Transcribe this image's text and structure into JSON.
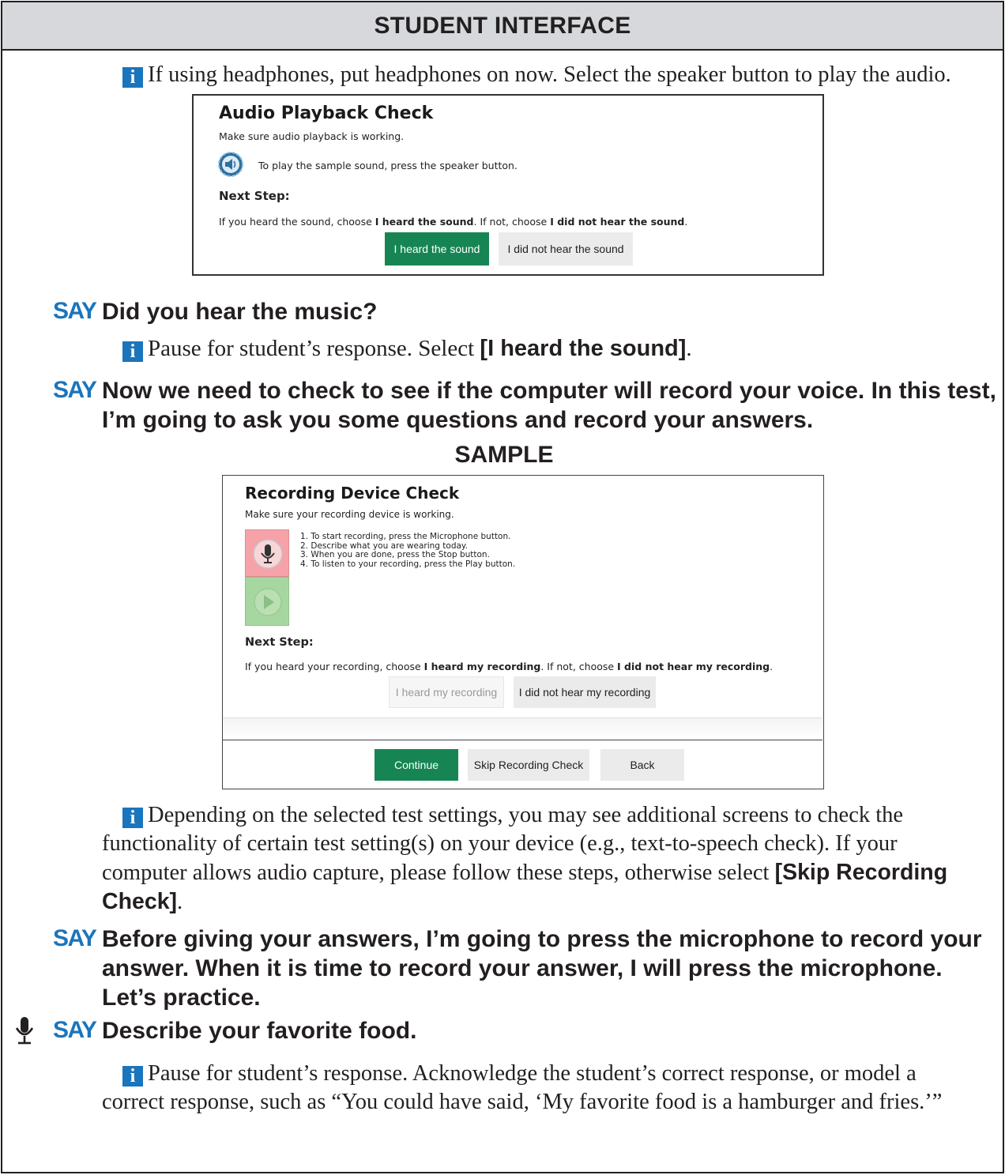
{
  "header": {
    "title": "STUDENT INTERFACE"
  },
  "info1": "If using headphones, put headphones on now. Select the speaker button to play the audio.",
  "audio_check": {
    "title": "Audio Playback Check",
    "subtitle": "Make sure audio playback is working.",
    "speaker_text": "To play the sample sound, press the speaker button.",
    "next_step": "Next Step:",
    "instr_pre": "If you heard the sound, choose ",
    "instr_b1": "I heard the sound",
    "instr_mid": ". If not, choose ",
    "instr_b2": "I did not hear the sound",
    "instr_end": ".",
    "btn_heard": "I heard the sound",
    "btn_not_heard": "I did not hear the sound"
  },
  "say_label": "SAY",
  "say1": "Did you hear the music?",
  "info2": {
    "pre": "Pause for student’s response. Select ",
    "bold": "[I heard the sound]",
    "end": "."
  },
  "say2": "Now we need to check to see if the computer will record your voice. In this test, I’m going to ask you some questions and record your answers.",
  "sample_label": "SAMPLE",
  "recording_check": {
    "title": "Recording Device Check",
    "subtitle": "Make sure your recording device is working.",
    "steps": [
      "1. To start recording, press the Microphone button.",
      "2. Describe what you are wearing today.",
      "3. When you are done, press the Stop button.",
      "4. To listen to your recording, press the Play button."
    ],
    "next_step": "Next Step:",
    "instr_pre": "If you heard your recording, choose ",
    "instr_b1": "I heard my recording",
    "instr_mid": ". If not, choose ",
    "instr_b2": "I did not hear my recording",
    "instr_end": ".",
    "btn_heard": "I heard my recording",
    "btn_not_heard": "I did not hear my recording",
    "btn_continue": "Continue",
    "btn_skip": "Skip Recording Check",
    "btn_back": "Back"
  },
  "info3": {
    "text": "Depending on the selected test settings, you may see additional screens to check the functionality of certain test setting(s) on your device (e.g., text-to-speech check). If your computer allows audio capture, please follow these steps, otherwise select ",
    "bold": "[Skip Recording Check]",
    "end": "."
  },
  "say3": "Before giving your answers, I’m going to press the microphone to record your answer. When it is time to record your answer, I will press the microphone. Let’s practice.",
  "say4": "Describe your favorite food.",
  "info4": "Pause for student’s response. Acknowledge the student’s correct response, or model a correct response, such as “You could have said, ‘My favorite food is a hamburger and fries.’”"
}
